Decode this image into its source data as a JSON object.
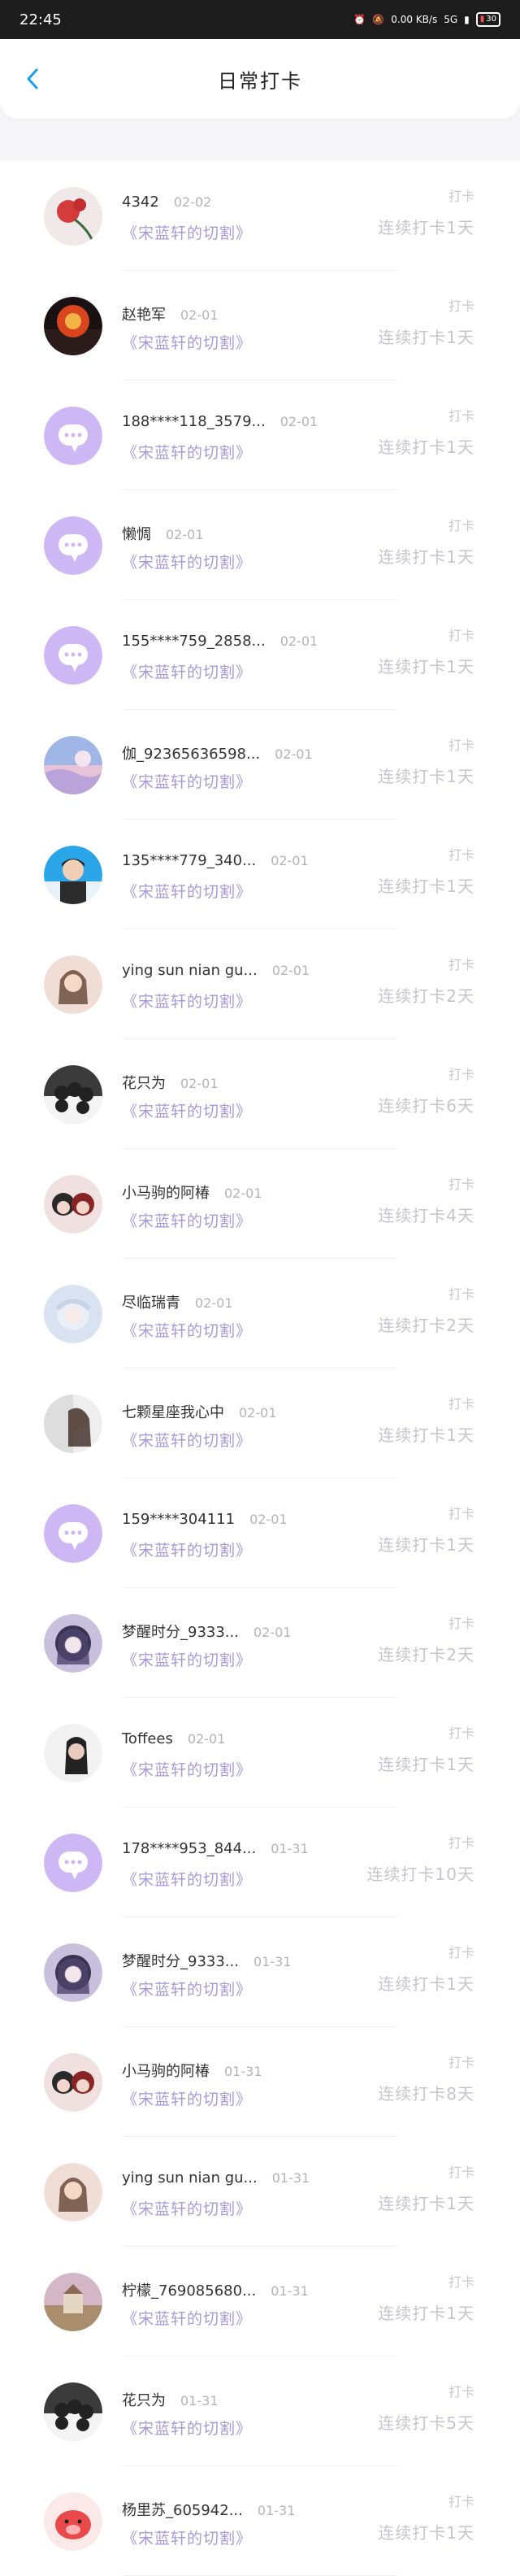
{
  "status_bar": {
    "time": "22:45",
    "net_speed": "0.00 KB/s",
    "network": "5G",
    "battery": "30"
  },
  "nav": {
    "title": "日常打卡"
  },
  "list": {
    "items": [
      {
        "name": "4342",
        "date": "02-02",
        "book": "《宋蓝轩的切割》",
        "tag": "打卡",
        "streak": "连续打卡1天",
        "avatar": "photo-rose"
      },
      {
        "name": "赵艳军",
        "date": "02-01",
        "book": "《宋蓝轩的切割》",
        "tag": "打卡",
        "streak": "连续打卡1天",
        "avatar": "photo-night"
      },
      {
        "name": "188****118_3579...",
        "date": "02-01",
        "book": "《宋蓝轩的切割》",
        "tag": "打卡",
        "streak": "连续打卡1天",
        "avatar": "default-chat"
      },
      {
        "name": "懒惆",
        "date": "02-01",
        "book": "《宋蓝轩的切割》",
        "tag": "打卡",
        "streak": "连续打卡1天",
        "avatar": "default-chat"
      },
      {
        "name": "155****759_2858...",
        "date": "02-01",
        "book": "《宋蓝轩的切割》",
        "tag": "打卡",
        "streak": "连续打卡1天",
        "avatar": "default-chat"
      },
      {
        "name": "伽_92365636598...",
        "date": "02-01",
        "book": "《宋蓝轩的切割》",
        "tag": "打卡",
        "streak": "连续打卡1天",
        "avatar": "photo-sky"
      },
      {
        "name": "135****779_340...",
        "date": "02-01",
        "book": "《宋蓝轩的切割》",
        "tag": "打卡",
        "streak": "连续打卡1天",
        "avatar": "photo-boy"
      },
      {
        "name": "ying sun nian gu...",
        "date": "02-01",
        "book": "《宋蓝轩的切割》",
        "tag": "打卡",
        "streak": "连续打卡2天",
        "avatar": "photo-girl-soft"
      },
      {
        "name": "花只为",
        "date": "02-01",
        "book": "《宋蓝轩的切割》",
        "tag": "打卡",
        "streak": "连续打卡6天",
        "avatar": "photo-cats"
      },
      {
        "name": "小马驹的阿椿",
        "date": "02-01",
        "book": "《宋蓝轩的切割》",
        "tag": "打卡",
        "streak": "连续打卡4天",
        "avatar": "photo-anime-red"
      },
      {
        "name": "尽临瑞青",
        "date": "02-01",
        "book": "《宋蓝轩的切割》",
        "tag": "打卡",
        "streak": "连续打卡2天",
        "avatar": "photo-anime-white"
      },
      {
        "name": "七颗星座我心中",
        "date": "02-01",
        "book": "《宋蓝轩的切割》",
        "tag": "打卡",
        "streak": "连续打卡1天",
        "avatar": "photo-girl-side"
      },
      {
        "name": "159****304111",
        "date": "02-01",
        "book": "《宋蓝轩的切割》",
        "tag": "打卡",
        "streak": "连续打卡1天",
        "avatar": "default-chat"
      },
      {
        "name": "梦醒时分_9333...",
        "date": "02-01",
        "book": "《宋蓝轩的切割》",
        "tag": "打卡",
        "streak": "连续打卡2天",
        "avatar": "photo-anime-purple"
      },
      {
        "name": "Toffees",
        "date": "02-01",
        "book": "《宋蓝轩的切割》",
        "tag": "打卡",
        "streak": "连续打卡1天",
        "avatar": "photo-girl-bw"
      },
      {
        "name": "178****953_844...",
        "date": "01-31",
        "book": "《宋蓝轩的切割》",
        "tag": "打卡",
        "streak": "连续打卡10天",
        "avatar": "default-chat"
      },
      {
        "name": "梦醒时分_9333...",
        "date": "01-31",
        "book": "《宋蓝轩的切割》",
        "tag": "打卡",
        "streak": "连续打卡1天",
        "avatar": "photo-anime-purple"
      },
      {
        "name": "小马驹的阿椿",
        "date": "01-31",
        "book": "《宋蓝轩的切割》",
        "tag": "打卡",
        "streak": "连续打卡8天",
        "avatar": "photo-anime-red"
      },
      {
        "name": "ying sun nian gu...",
        "date": "01-31",
        "book": "《宋蓝轩的切割》",
        "tag": "打卡",
        "streak": "连续打卡1天",
        "avatar": "photo-girl-soft"
      },
      {
        "name": "柠檬_769085680...",
        "date": "01-31",
        "book": "《宋蓝轩的切割》",
        "tag": "打卡",
        "streak": "连续打卡1天",
        "avatar": "photo-castle"
      },
      {
        "name": "花只为",
        "date": "01-31",
        "book": "《宋蓝轩的切割》",
        "tag": "打卡",
        "streak": "连续打卡5天",
        "avatar": "photo-cats"
      },
      {
        "name": "杨里苏_605942...",
        "date": "01-31",
        "book": "《宋蓝轩的切割》",
        "tag": "打卡",
        "streak": "连续打卡1天",
        "avatar": "photo-pig"
      }
    ]
  },
  "colors": {
    "accent": "#a79ad9",
    "back_arrow": "#1a9ef0",
    "default_avatar_bg": "#cdb7f4"
  }
}
